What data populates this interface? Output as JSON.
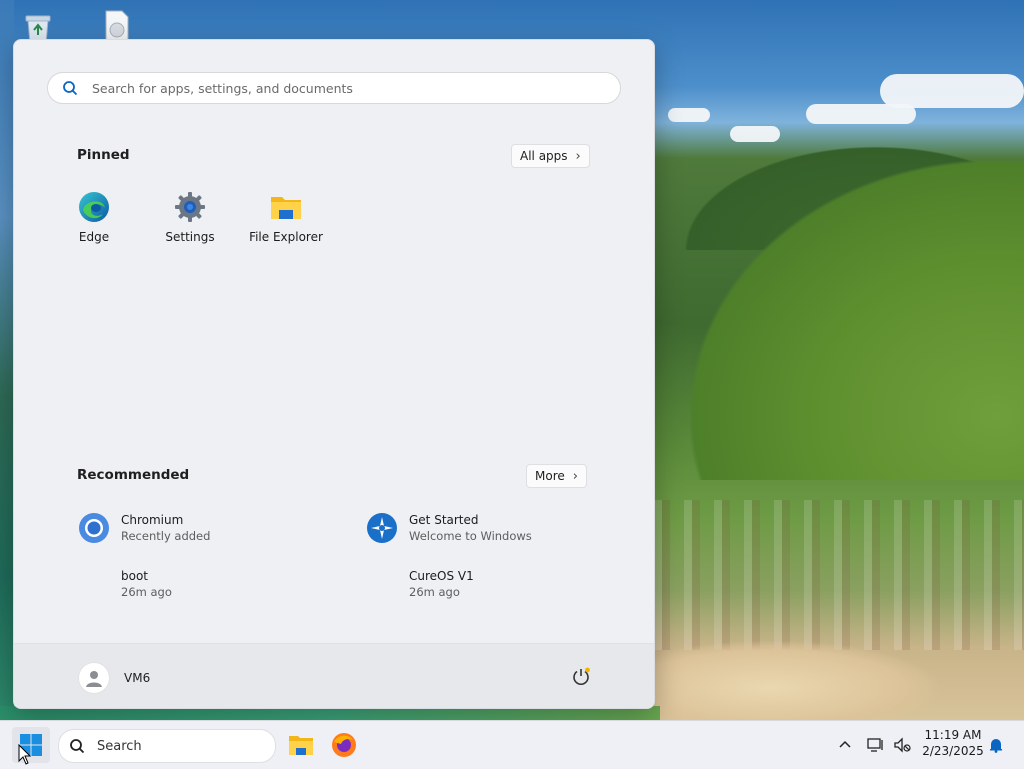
{
  "search": {
    "placeholder": "Search for apps, settings, and documents"
  },
  "pinned": {
    "title": "Pinned",
    "all_apps_label": "All apps",
    "apps": [
      {
        "label": "Edge",
        "icon": "edge-icon"
      },
      {
        "label": "Settings",
        "icon": "settings-gear-icon"
      },
      {
        "label": "File Explorer",
        "icon": "folder-icon"
      }
    ]
  },
  "recommended": {
    "title": "Recommended",
    "more_label": "More",
    "items": [
      {
        "name": "Chromium",
        "sub": "Recently added",
        "icon": "chromium-icon"
      },
      {
        "name": "Get Started",
        "sub": "Welcome to Windows",
        "icon": "get-started-icon"
      },
      {
        "name": "boot",
        "sub": "26m ago",
        "icon": "none"
      },
      {
        "name": "CureOS V1",
        "sub": "26m ago",
        "icon": "none"
      }
    ]
  },
  "footer": {
    "user_name": "VM6"
  },
  "taskbar": {
    "search_label": "Search",
    "clock_time": "11:19 AM",
    "clock_date": "2/23/2025"
  },
  "colors": {
    "accent": "#0a66c2",
    "menu_bg": "#eef0f4",
    "taskbar_bg": "#eef0f5"
  }
}
